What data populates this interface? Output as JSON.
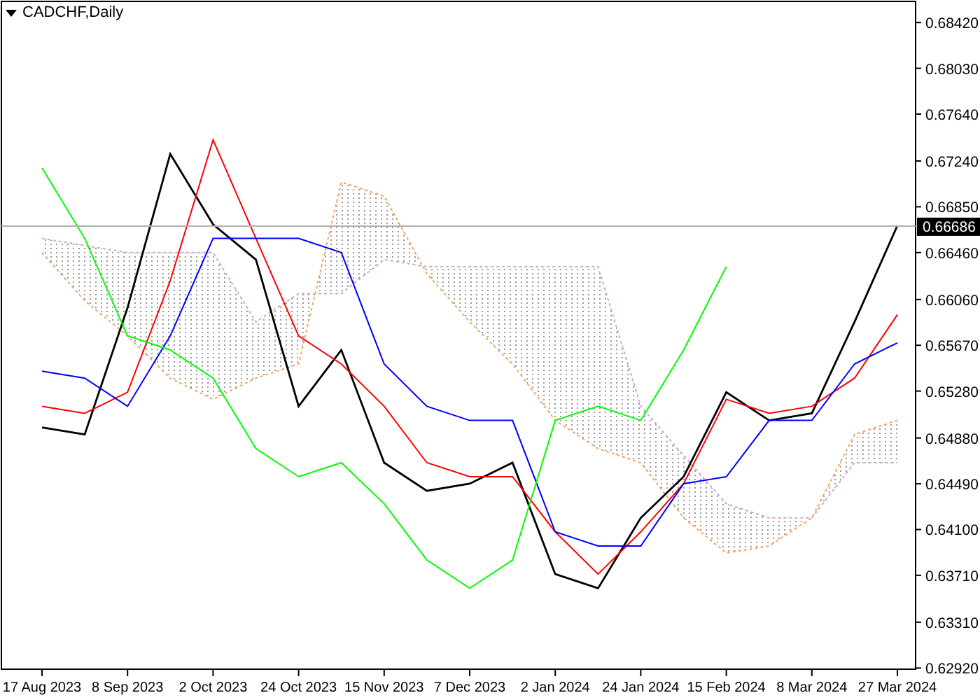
{
  "chart": {
    "title": "CADCHF,Daily",
    "chart_data": {
      "type": "line",
      "categories": [
        "17 Aug 2023",
        null,
        "8 Sep 2023",
        null,
        "2 Oct 2023",
        null,
        "24 Oct 2023",
        null,
        "15 Nov 2023",
        null,
        "7 Dec 2023",
        null,
        "2 Jan 2024",
        null,
        "24 Jan 2024",
        null,
        "15 Feb 2024",
        null,
        "8 Mar 2024",
        null,
        "27 Mar 2024"
      ],
      "ylim": [
        0.6291,
        0.686
      ],
      "yticks": [
        {
          "value": 0.6842,
          "label": "0.68420"
        },
        {
          "value": 0.6803,
          "label": "0.68030"
        },
        {
          "value": 0.6764,
          "label": "0.67640"
        },
        {
          "value": 0.6724,
          "label": "0.67240"
        },
        {
          "value": 0.6685,
          "label": "0.66850"
        },
        {
          "value": 0.6646,
          "label": "0.66460"
        },
        {
          "value": 0.6606,
          "label": "0.66060"
        },
        {
          "value": 0.6567,
          "label": "0.65670"
        },
        {
          "value": 0.6528,
          "label": "0.65280"
        },
        {
          "value": 0.6488,
          "label": "0.64880"
        },
        {
          "value": 0.6449,
          "label": "0.64490"
        },
        {
          "value": 0.641,
          "label": "0.64100"
        },
        {
          "value": 0.6371,
          "label": "0.63710"
        },
        {
          "value": 0.6331,
          "label": "0.63310"
        },
        {
          "value": 0.6292,
          "label": "0.62920"
        }
      ],
      "ref_lines": [
        {
          "axis": "y",
          "value": 0.66686,
          "label": "0.66686",
          "color": "#b0b0b0"
        }
      ],
      "series": [
        {
          "color": "#f4a460",
          "line_style": "dashed",
          "values": [
            0.6646,
            0.6605,
            0.6575,
            0.6539,
            0.6521,
            0.6539,
            0.6551,
            0.6706,
            0.6694,
            0.6628,
            0.6587,
            0.6551,
            0.6503,
            0.6479,
            0.6467,
            0.642,
            0.639,
            0.6396,
            0.642,
            0.6491,
            0.6503
          ]
        },
        {
          "color": "#d8a0d8",
          "line_style": "dashed",
          "values": [
            0.6658,
            0.6652,
            0.6646,
            0.6646,
            0.6646,
            0.6587,
            0.6611,
            0.6611,
            0.664,
            0.6634,
            0.6634,
            0.6634,
            0.6634,
            0.6634,
            0.6515,
            0.6473,
            0.6432,
            0.642,
            0.642,
            0.6467,
            0.6467
          ]
        },
        {
          "color": "#000000",
          "line_style": "solid",
          "values": [
            0.6497,
            0.6491,
            0.6599,
            0.673,
            0.667,
            0.664,
            0.6515,
            0.6563,
            0.6467,
            0.6443,
            0.6449,
            0.6467,
            0.6372,
            0.636,
            0.642,
            0.6455,
            0.6527,
            0.6503,
            0.6509,
            0.6587,
            0.6669
          ]
        },
        {
          "color": "#ff0000",
          "line_style": "solid",
          "values": [
            0.6515,
            0.6509,
            0.6527,
            0.6622,
            0.6742,
            0.6658,
            0.6575,
            0.6551,
            0.6515,
            0.6467,
            0.6455,
            0.6455,
            0.6408,
            0.6372,
            0.6408,
            0.6449,
            0.6521,
            0.6509,
            0.6515,
            0.6539,
            0.6593
          ]
        },
        {
          "color": "#0000ff",
          "line_style": "solid",
          "values": [
            0.6545,
            0.6539,
            0.6515,
            0.6575,
            0.6658,
            0.6658,
            0.6658,
            0.6646,
            0.6551,
            0.6515,
            0.6503,
            0.6503,
            0.6408,
            0.6396,
            0.6396,
            0.6449,
            0.6455,
            0.6503,
            0.6503,
            0.6551,
            0.6569
          ]
        },
        {
          "color": "#00ff00",
          "line_style": "solid",
          "values": [
            0.6718,
            0.6658,
            0.6575,
            0.6563,
            0.6539,
            0.6479,
            0.6455,
            0.6467,
            0.6432,
            0.6384,
            0.636,
            0.6384,
            0.6503,
            0.6515,
            0.6503,
            0.6563,
            0.6634,
            null,
            null,
            null,
            null
          ]
        }
      ]
    }
  }
}
